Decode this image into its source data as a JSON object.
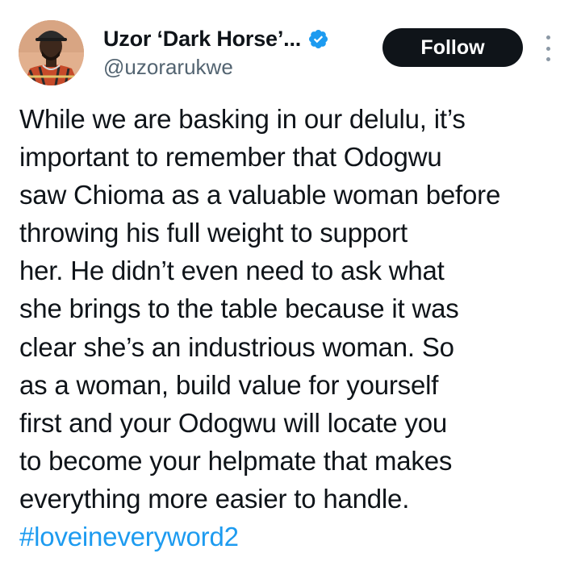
{
  "tweet": {
    "author": {
      "display_name": "Uzor ‘Dark Horse’...",
      "handle": "@uzorarukwe",
      "verified": true
    },
    "follow_label": "Follow",
    "text_lines": [
      "While we are basking in our delulu, it’s",
      "important to remember that Odogwu",
      "saw Chioma as a valuable woman before",
      "throwing his full weight to support",
      "her. He didn’t even need to ask what",
      "she brings to the table because it was",
      "clear she’s an industrious woman. So",
      "as a woman, build value for yourself",
      "first and your Odogwu will locate you",
      "to become your helpmate that makes",
      "everything more easier to handle."
    ],
    "hashtag": "#loveineveryword2"
  },
  "colors": {
    "text": "#0f1419",
    "secondary_text": "#536471",
    "link": "#1d9bf0",
    "follow_button_bg": "#0f1419",
    "verified_badge": "#1d9bf0"
  },
  "icons": {
    "verified": "verified-badge-icon",
    "more": "more-vertical-icon"
  }
}
